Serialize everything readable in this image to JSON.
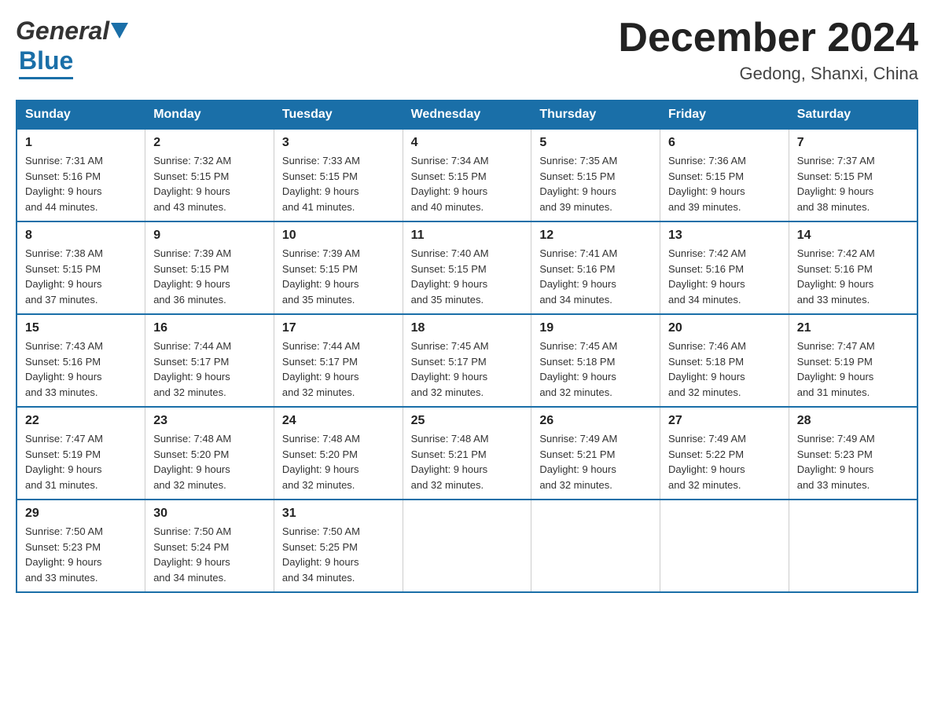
{
  "header": {
    "month_title": "December 2024",
    "location": "Gedong, Shanxi, China",
    "logo_general": "General",
    "logo_blue": "Blue"
  },
  "weekdays": [
    "Sunday",
    "Monday",
    "Tuesday",
    "Wednesday",
    "Thursday",
    "Friday",
    "Saturday"
  ],
  "weeks": [
    [
      {
        "day": "1",
        "sunrise": "7:31 AM",
        "sunset": "5:16 PM",
        "daylight": "9 hours and 44 minutes."
      },
      {
        "day": "2",
        "sunrise": "7:32 AM",
        "sunset": "5:15 PM",
        "daylight": "9 hours and 43 minutes."
      },
      {
        "day": "3",
        "sunrise": "7:33 AM",
        "sunset": "5:15 PM",
        "daylight": "9 hours and 41 minutes."
      },
      {
        "day": "4",
        "sunrise": "7:34 AM",
        "sunset": "5:15 PM",
        "daylight": "9 hours and 40 minutes."
      },
      {
        "day": "5",
        "sunrise": "7:35 AM",
        "sunset": "5:15 PM",
        "daylight": "9 hours and 39 minutes."
      },
      {
        "day": "6",
        "sunrise": "7:36 AM",
        "sunset": "5:15 PM",
        "daylight": "9 hours and 39 minutes."
      },
      {
        "day": "7",
        "sunrise": "7:37 AM",
        "sunset": "5:15 PM",
        "daylight": "9 hours and 38 minutes."
      }
    ],
    [
      {
        "day": "8",
        "sunrise": "7:38 AM",
        "sunset": "5:15 PM",
        "daylight": "9 hours and 37 minutes."
      },
      {
        "day": "9",
        "sunrise": "7:39 AM",
        "sunset": "5:15 PM",
        "daylight": "9 hours and 36 minutes."
      },
      {
        "day": "10",
        "sunrise": "7:39 AM",
        "sunset": "5:15 PM",
        "daylight": "9 hours and 35 minutes."
      },
      {
        "day": "11",
        "sunrise": "7:40 AM",
        "sunset": "5:15 PM",
        "daylight": "9 hours and 35 minutes."
      },
      {
        "day": "12",
        "sunrise": "7:41 AM",
        "sunset": "5:16 PM",
        "daylight": "9 hours and 34 minutes."
      },
      {
        "day": "13",
        "sunrise": "7:42 AM",
        "sunset": "5:16 PM",
        "daylight": "9 hours and 34 minutes."
      },
      {
        "day": "14",
        "sunrise": "7:42 AM",
        "sunset": "5:16 PM",
        "daylight": "9 hours and 33 minutes."
      }
    ],
    [
      {
        "day": "15",
        "sunrise": "7:43 AM",
        "sunset": "5:16 PM",
        "daylight": "9 hours and 33 minutes."
      },
      {
        "day": "16",
        "sunrise": "7:44 AM",
        "sunset": "5:17 PM",
        "daylight": "9 hours and 32 minutes."
      },
      {
        "day": "17",
        "sunrise": "7:44 AM",
        "sunset": "5:17 PM",
        "daylight": "9 hours and 32 minutes."
      },
      {
        "day": "18",
        "sunrise": "7:45 AM",
        "sunset": "5:17 PM",
        "daylight": "9 hours and 32 minutes."
      },
      {
        "day": "19",
        "sunrise": "7:45 AM",
        "sunset": "5:18 PM",
        "daylight": "9 hours and 32 minutes."
      },
      {
        "day": "20",
        "sunrise": "7:46 AM",
        "sunset": "5:18 PM",
        "daylight": "9 hours and 32 minutes."
      },
      {
        "day": "21",
        "sunrise": "7:47 AM",
        "sunset": "5:19 PM",
        "daylight": "9 hours and 31 minutes."
      }
    ],
    [
      {
        "day": "22",
        "sunrise": "7:47 AM",
        "sunset": "5:19 PM",
        "daylight": "9 hours and 31 minutes."
      },
      {
        "day": "23",
        "sunrise": "7:48 AM",
        "sunset": "5:20 PM",
        "daylight": "9 hours and 32 minutes."
      },
      {
        "day": "24",
        "sunrise": "7:48 AM",
        "sunset": "5:20 PM",
        "daylight": "9 hours and 32 minutes."
      },
      {
        "day": "25",
        "sunrise": "7:48 AM",
        "sunset": "5:21 PM",
        "daylight": "9 hours and 32 minutes."
      },
      {
        "day": "26",
        "sunrise": "7:49 AM",
        "sunset": "5:21 PM",
        "daylight": "9 hours and 32 minutes."
      },
      {
        "day": "27",
        "sunrise": "7:49 AM",
        "sunset": "5:22 PM",
        "daylight": "9 hours and 32 minutes."
      },
      {
        "day": "28",
        "sunrise": "7:49 AM",
        "sunset": "5:23 PM",
        "daylight": "9 hours and 33 minutes."
      }
    ],
    [
      {
        "day": "29",
        "sunrise": "7:50 AM",
        "sunset": "5:23 PM",
        "daylight": "9 hours and 33 minutes."
      },
      {
        "day": "30",
        "sunrise": "7:50 AM",
        "sunset": "5:24 PM",
        "daylight": "9 hours and 34 minutes."
      },
      {
        "day": "31",
        "sunrise": "7:50 AM",
        "sunset": "5:25 PM",
        "daylight": "9 hours and 34 minutes."
      },
      null,
      null,
      null,
      null
    ]
  ],
  "labels": {
    "sunrise": "Sunrise:",
    "sunset": "Sunset:",
    "daylight": "Daylight:"
  }
}
